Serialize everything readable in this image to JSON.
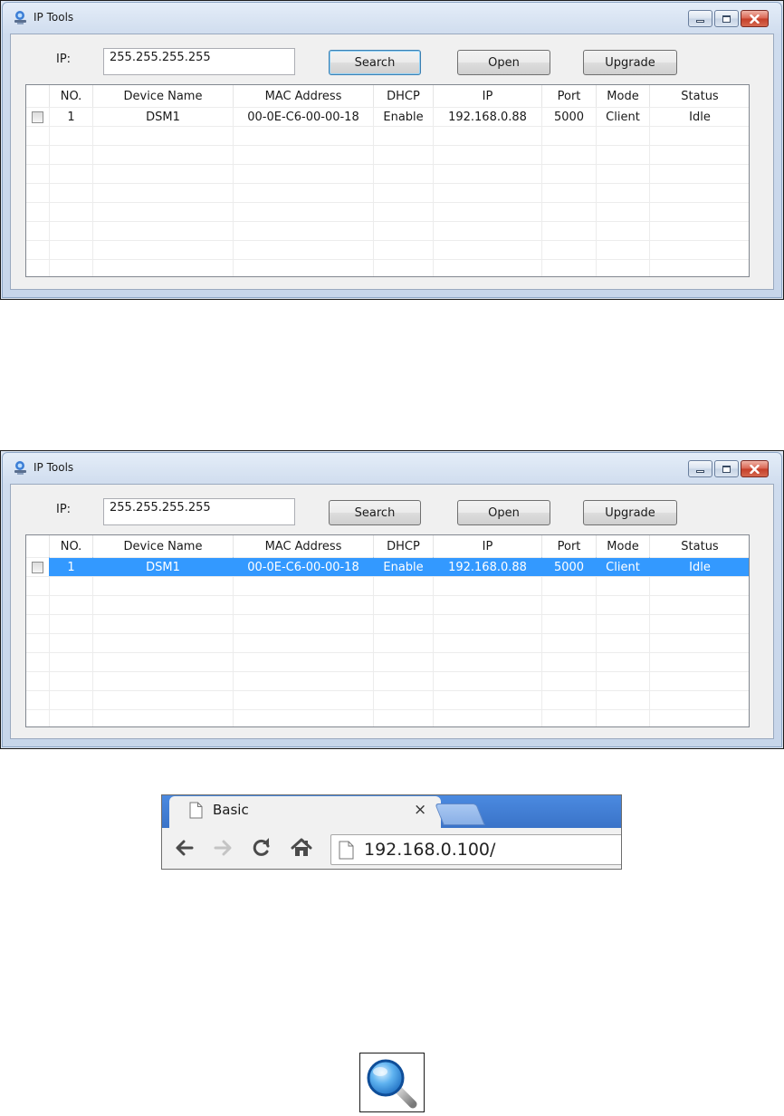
{
  "windows": [
    {
      "title": "IP Tools",
      "ip_label": "IP:",
      "ip_value": "255.255.255.255",
      "buttons": {
        "search": "Search",
        "open": "Open",
        "upgrade": "Upgrade"
      },
      "columns": [
        "NO.",
        "Device Name",
        "MAC Address",
        "DHCP",
        "IP",
        "Port",
        "Mode",
        "Status"
      ],
      "rows": [
        {
          "no": "1",
          "device_name": "DSM1",
          "mac": "00-0E-C6-00-00-18",
          "dhcp": "Enable",
          "ip": "192.168.0.88",
          "port": "5000",
          "mode": "Client",
          "status": "Idle",
          "selected": false
        }
      ]
    },
    {
      "title": "IP Tools",
      "ip_label": "IP:",
      "ip_value": "255.255.255.255",
      "buttons": {
        "search": "Search",
        "open": "Open",
        "upgrade": "Upgrade"
      },
      "columns": [
        "NO.",
        "Device Name",
        "MAC Address",
        "DHCP",
        "IP",
        "Port",
        "Mode",
        "Status"
      ],
      "rows": [
        {
          "no": "1",
          "device_name": "DSM1",
          "mac": "00-0E-C6-00-00-18",
          "dhcp": "Enable",
          "ip": "192.168.0.88",
          "port": "5000",
          "mode": "Client",
          "status": "Idle",
          "selected": true
        }
      ]
    }
  ],
  "browser": {
    "tab_title": "Basic",
    "tab_close": "×",
    "url": "192.168.0.100/"
  },
  "colors": {
    "selection": "#3399ff",
    "window_frame": "#c7d6ea",
    "tabstrip": "#3a73c8",
    "close_button": "#c43e28"
  },
  "icons": {
    "app": "network-computer-icon",
    "search": "magnifying-glass-icon",
    "back": "back-arrow-icon",
    "forward": "forward-arrow-icon",
    "reload": "reload-icon",
    "home": "home-icon",
    "page": "document-icon"
  }
}
